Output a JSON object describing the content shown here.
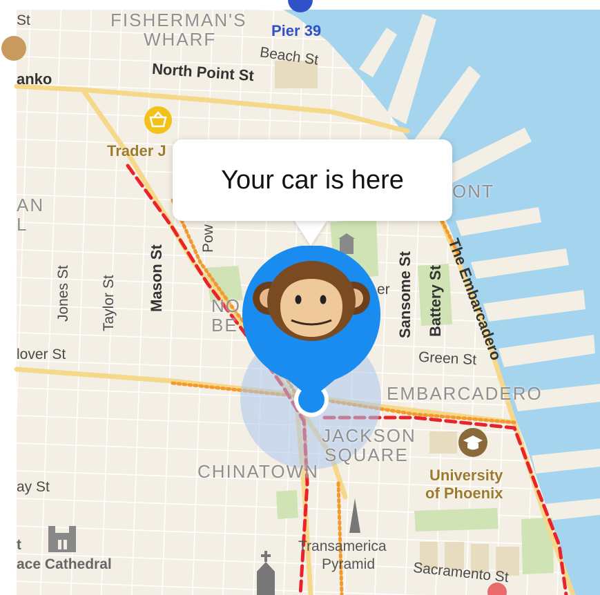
{
  "callout": {
    "text": "Your car is here"
  },
  "neighborhoods": {
    "fishermans_wharf_1": "FISHERMAN'S",
    "fishermans_wharf_2": "WHARF",
    "north_beach_1": "NO",
    "north_beach_2": "BE",
    "embarcadero": "EMBARCADERO",
    "jackson_square_1": "JACKSON",
    "jackson_square_2": "SQUARE",
    "chinatown": "CHINATOWN",
    "left_partial_1": "AN",
    "left_partial_2": "L",
    "ont_partial": "ONT"
  },
  "streets": {
    "north_point": "North Point St",
    "beach": "Beach St",
    "mason": "Mason St",
    "taylor": "Taylor St",
    "jones": "Jones St",
    "powell_partial": "Pow",
    "sansome": "Sansome St",
    "battery": "Battery St",
    "embarcadero": "The Embarcadero",
    "green": "Green St",
    "lover_partial": "lover St",
    "sacramento": "Sacramento St",
    "st_partial_top": "St",
    "ay_partial": "ay St",
    "er_partial": "er"
  },
  "pois": {
    "pier39": "Pier 39",
    "trader_joes": "Trader J",
    "danko": "anko",
    "university_1": "University",
    "university_2": "of Phoenix",
    "transamerica_1": "Transamerica",
    "transamerica_2": "Pyramid",
    "cathedral": "ace Cathedral",
    "cathedral_t": "t"
  },
  "colors": {
    "land": "#f4efe4",
    "water": "#a5d4ef",
    "park": "#cfe3b4",
    "main_road": "#f6d88a",
    "transit_red": "#e8232c",
    "transit_orange": "#f29a2e",
    "pin_blue": "#1a8cf0",
    "accuracy_circle": "#a9c6ee"
  },
  "icons": {
    "pin": "monkey-face-icon",
    "location": "location-dot-icon",
    "grocery": "basket-icon",
    "education": "graduation-cap-icon",
    "landmark": "pyramid-icon",
    "church": "church-icon",
    "cathedral": "cathedral-icon",
    "library": "building-icon"
  }
}
